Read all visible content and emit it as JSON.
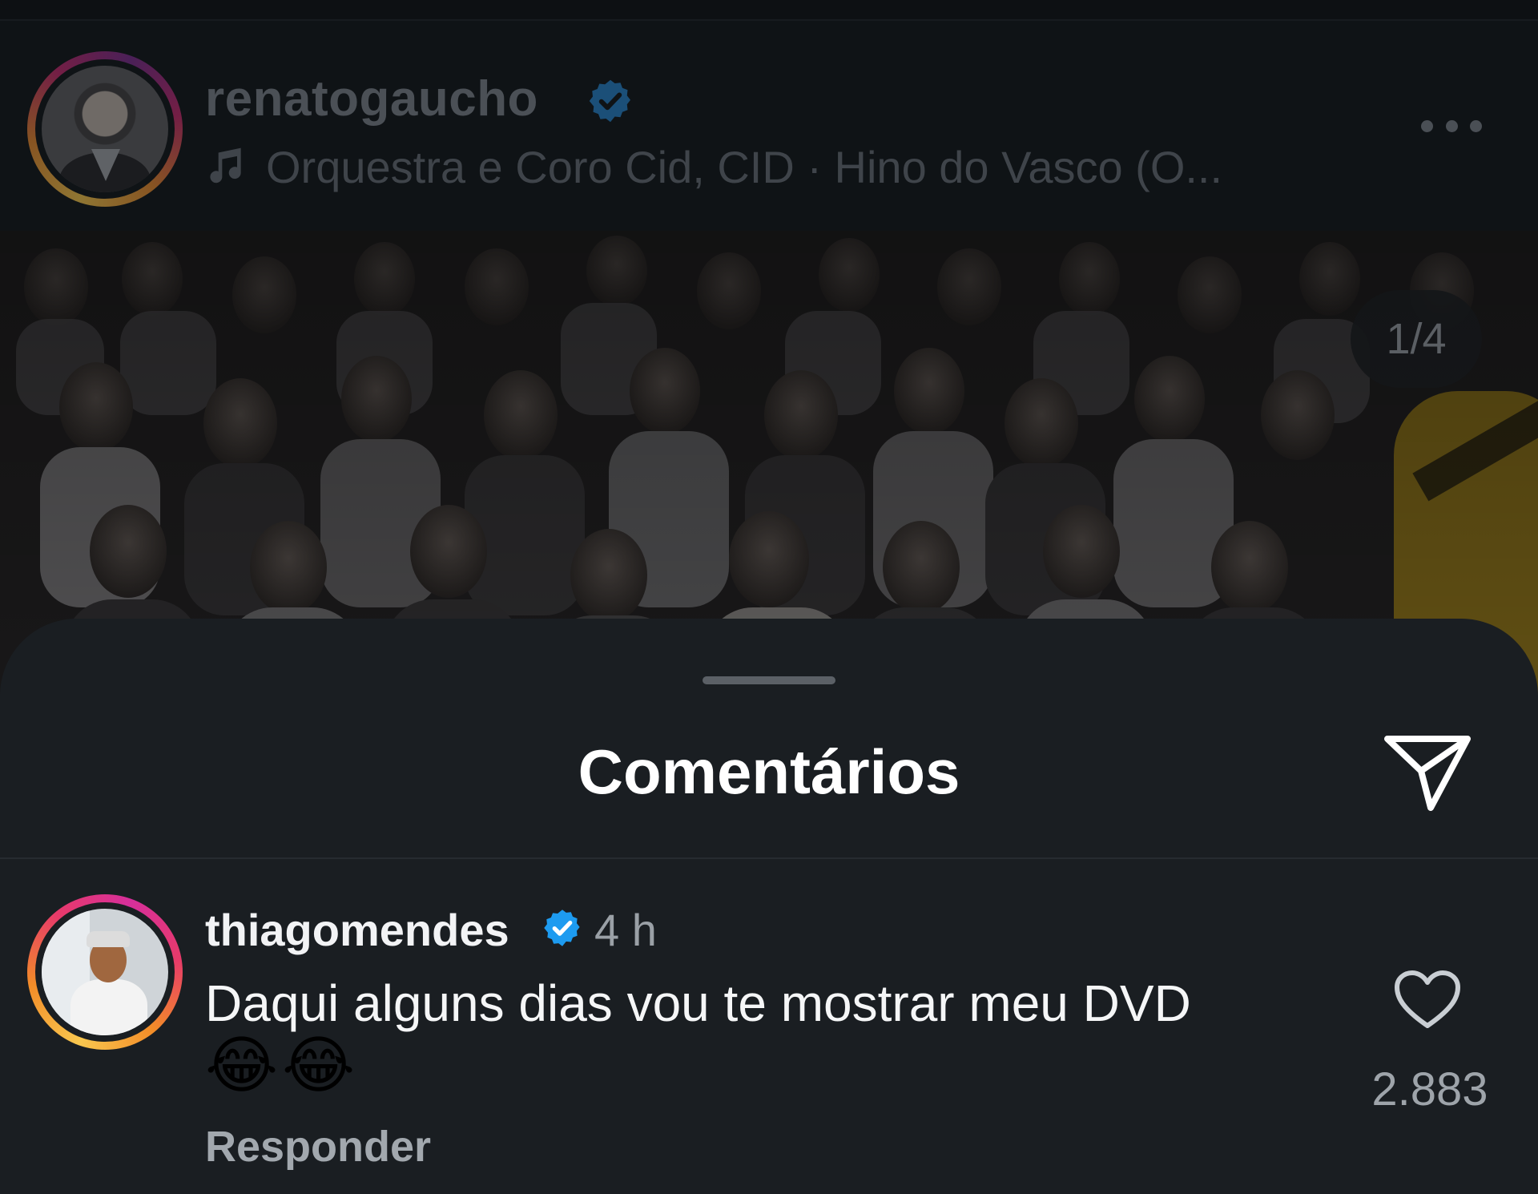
{
  "post": {
    "username": "renatogaucho",
    "music": "Orquestra e Coro Cid, CID · Hino do Vasco (O...",
    "image_counter": "1/4"
  },
  "comments_sheet": {
    "title": "Comentários"
  },
  "comment": {
    "username": "thiagomendes",
    "time": "4 h",
    "text": "Daqui alguns dias vou te mostrar meu DVD",
    "emoji_1": "😂",
    "emoji_2": "😂",
    "reply_label": "Responder",
    "likes": "2.883"
  },
  "colors": {
    "verified": "#1d9bf0",
    "sheet_background": "#1a1e22"
  }
}
